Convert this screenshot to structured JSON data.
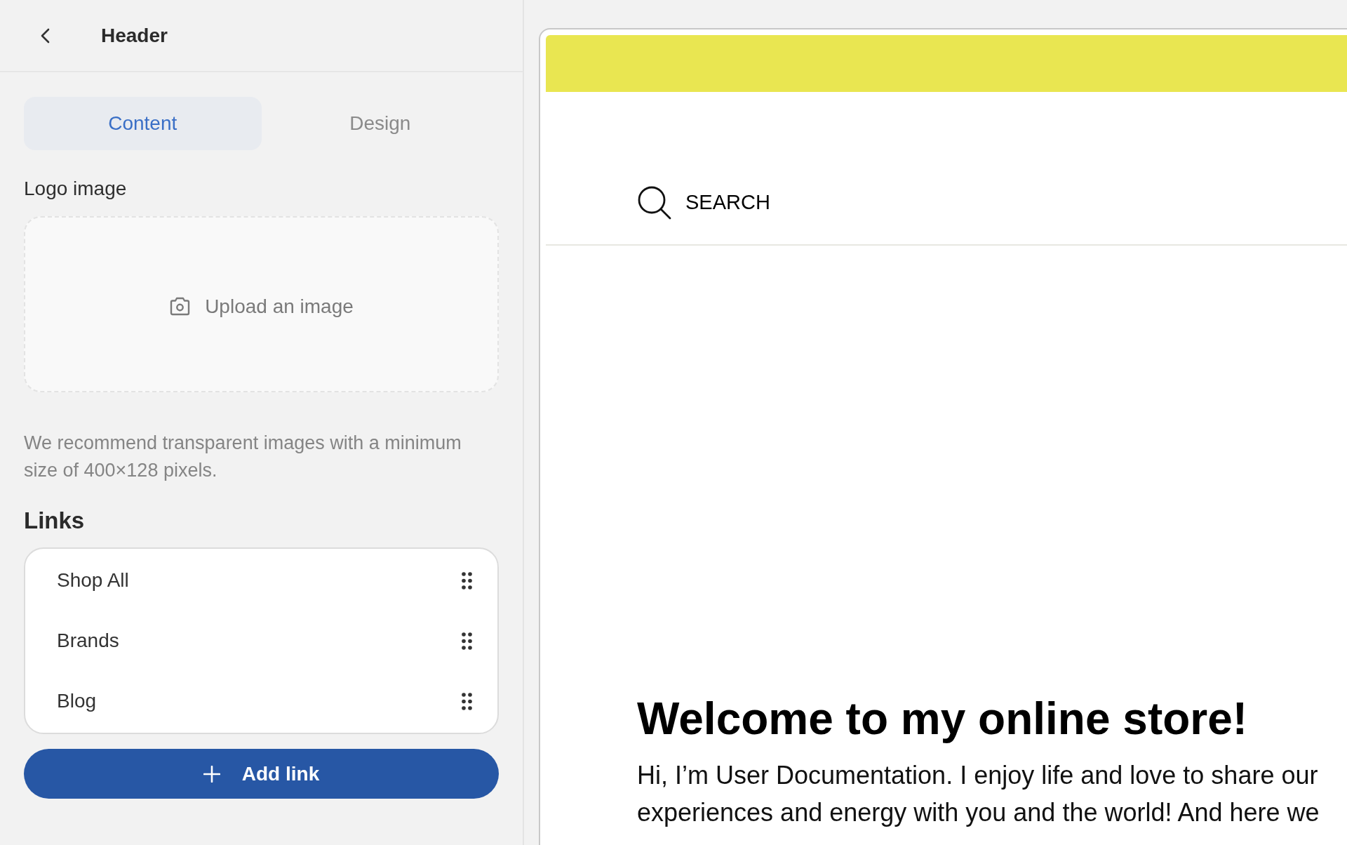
{
  "panel": {
    "title": "Header"
  },
  "tabs": [
    {
      "label": "Content",
      "selected": true
    },
    {
      "label": "Design",
      "selected": false
    }
  ],
  "logo_image": {
    "label": "Logo image",
    "upload_label": "Upload an image",
    "hint": "We recommend transparent images with a minimum size of 400×128 pixels."
  },
  "links": {
    "heading": "Links",
    "items": [
      {
        "label": "Shop All"
      },
      {
        "label": "Brands"
      },
      {
        "label": "Blog"
      }
    ],
    "add_button": "Add link"
  },
  "preview": {
    "search_label": "SEARCH",
    "heading": "Welcome to my online store!",
    "body": "Hi, I’m User Documentation. I enjoy life and love to share our\nexperiences and energy with you and the world! And here we"
  }
}
